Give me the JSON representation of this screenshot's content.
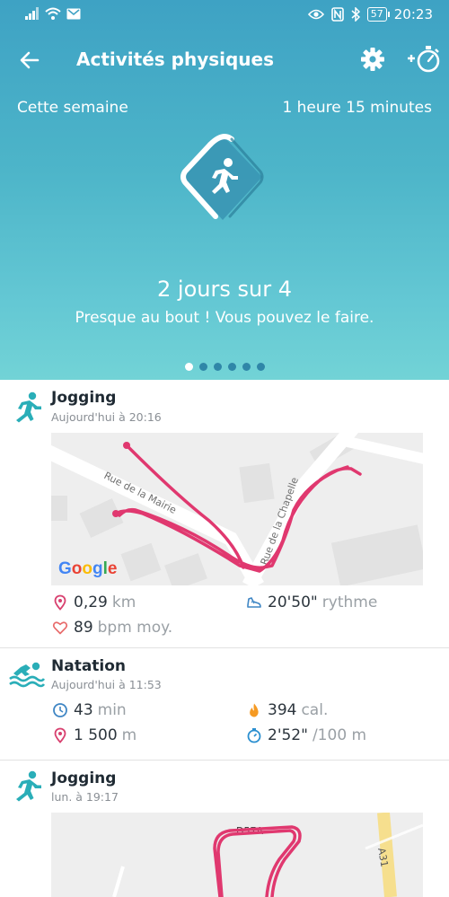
{
  "status_bar": {
    "battery": "57",
    "time": "20:23"
  },
  "header": {
    "title": "Activités physiques",
    "period_label": "Cette semaine",
    "period_total": "1 heure 15 minutes",
    "progress": "2 jours sur 4",
    "message": "Presque au bout ! Vous pouvez le faire.",
    "pager": {
      "count": 6,
      "active_index": 0
    }
  },
  "activities": [
    {
      "type": "Jogging",
      "time": "Aujourd'hui à 20:16",
      "map": {
        "streets": [
          "Rue de la Mairie",
          "Rue de la Chapelle"
        ],
        "attribution": "Google"
      },
      "stats": [
        {
          "icon": "location-pin-icon",
          "value": "0,29",
          "unit": "km"
        },
        {
          "icon": "shoe-icon",
          "value": "20'50\"",
          "unit": "rythme"
        },
        {
          "icon": "heart-icon",
          "value": "89",
          "unit": "bpm moy."
        }
      ]
    },
    {
      "type": "Natation",
      "time": "Aujourd'hui à 11:53",
      "stats": [
        {
          "icon": "clock-icon",
          "value": "43",
          "unit": "min"
        },
        {
          "icon": "flame-icon",
          "value": "394",
          "unit": "cal."
        },
        {
          "icon": "location-pin-icon",
          "value": "1 500",
          "unit": "m"
        },
        {
          "icon": "stopwatch-icon",
          "value": "2'52\"",
          "unit": "/100  m"
        }
      ]
    },
    {
      "type": "Jogging",
      "time": "lun. à 19:17",
      "map": {
        "road_labels": [
          "D57A",
          "A31"
        ]
      }
    }
  ],
  "colors": {
    "header_top": "#3ea2c4",
    "header_bottom": "#72d3d6",
    "route": "#e0386f",
    "activity_icon": "#2aaeb8"
  }
}
